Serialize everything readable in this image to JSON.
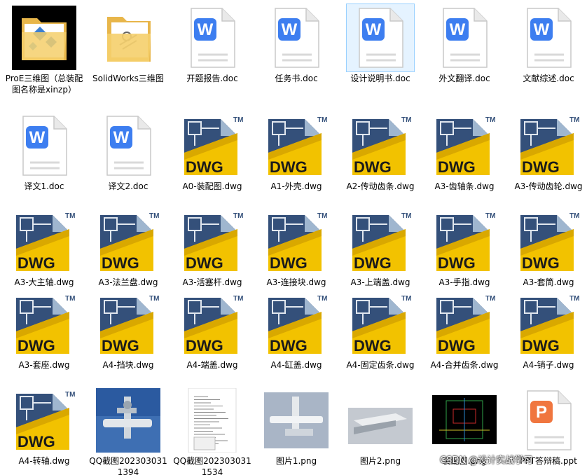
{
  "items": [
    {
      "type": "folder-dark",
      "label": "ProE三维图（总装配图名称是xinzp）"
    },
    {
      "type": "folder-light",
      "label": "SolidWorks三维图"
    },
    {
      "type": "word",
      "label": "开题报告.doc"
    },
    {
      "type": "word",
      "label": "任务书.doc"
    },
    {
      "type": "word",
      "label": "设计说明书.doc",
      "selected": true
    },
    {
      "type": "word",
      "label": "外文翻译.doc"
    },
    {
      "type": "word",
      "label": "文献综述.doc"
    },
    {
      "type": "word",
      "label": "译文1.doc"
    },
    {
      "type": "word",
      "label": "译文2.doc"
    },
    {
      "type": "dwg",
      "label": "A0-装配图.dwg"
    },
    {
      "type": "dwg",
      "label": "A1-外壳.dwg"
    },
    {
      "type": "dwg",
      "label": "A2-传动齿条.dwg"
    },
    {
      "type": "dwg",
      "label": "A3-齿轴条.dwg"
    },
    {
      "type": "dwg",
      "label": "A3-传动齿轮.dwg"
    },
    {
      "type": "dwg",
      "label": "A3-大主轴.dwg"
    },
    {
      "type": "dwg",
      "label": "A3-法兰盘.dwg"
    },
    {
      "type": "dwg",
      "label": "A3-活塞杆.dwg"
    },
    {
      "type": "dwg",
      "label": "A3-连接块.dwg"
    },
    {
      "type": "dwg",
      "label": "A3-上端盖.dwg"
    },
    {
      "type": "dwg",
      "label": "A3-手指.dwg"
    },
    {
      "type": "dwg",
      "label": "A3-套筒.dwg"
    },
    {
      "type": "dwg",
      "label": "A3-套座.dwg"
    },
    {
      "type": "dwg",
      "label": "A4-挡块.dwg"
    },
    {
      "type": "dwg",
      "label": "A4-端盖.dwg"
    },
    {
      "type": "dwg",
      "label": "A4-缸盖.dwg"
    },
    {
      "type": "dwg",
      "label": "A4-固定齿条.dwg"
    },
    {
      "type": "dwg",
      "label": "A4-合并齿条.dwg"
    },
    {
      "type": "dwg",
      "label": "A4-销子.dwg"
    },
    {
      "type": "dwg",
      "label": "A4-转轴.dwg"
    },
    {
      "type": "thumb-blue",
      "label": "QQ截图2023030311394"
    },
    {
      "type": "thumb-doc",
      "label": "QQ截图2023030311534"
    },
    {
      "type": "thumb-gray",
      "label": "图片1.png"
    },
    {
      "type": "thumb-gray2",
      "label": "图片2.png"
    },
    {
      "type": "thumb-black",
      "label": "装配图.png"
    },
    {
      "type": "ppt",
      "label": "PPT答辩稿.ppt"
    }
  ],
  "icon_texts": {
    "dwg": "DWG",
    "tm": "TM",
    "word": "W",
    "ppt": "P"
  },
  "watermark": "CSDN @设计实战学习",
  "colors": {
    "word_blue": "#3d7ef0",
    "ppt_orange": "#f0763f",
    "dwg_yellow": "#f2c200",
    "dwg_navy": "#34507a"
  }
}
